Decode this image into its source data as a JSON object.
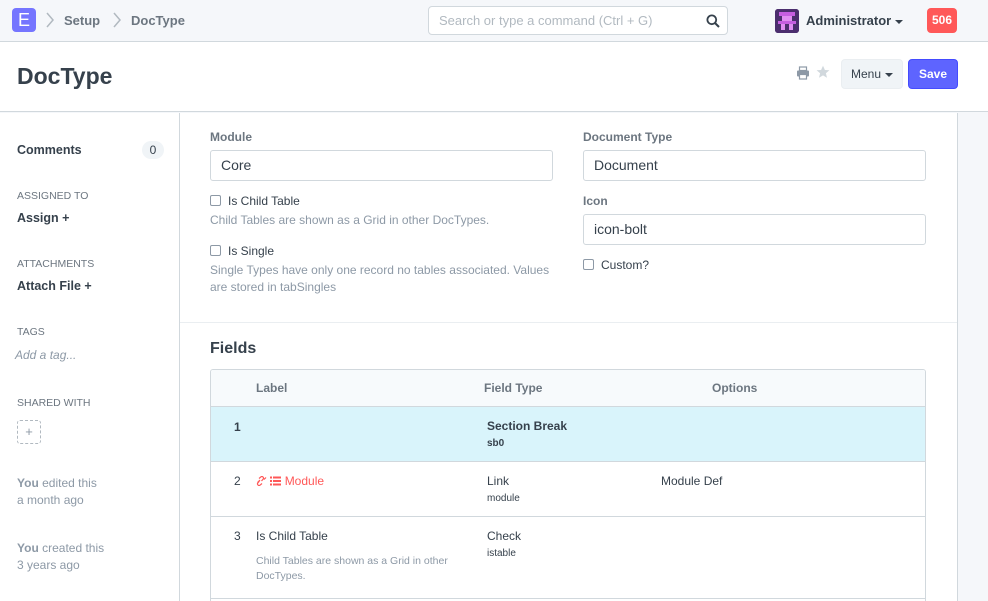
{
  "navbar": {
    "logo_letter": "E",
    "breadcrumbs": [
      "Setup",
      "DocType"
    ],
    "search_placeholder": "Search or type a command (Ctrl + G)",
    "user_name": "Administrator",
    "notification_count": "506"
  },
  "page": {
    "title": "DocType",
    "menu_label": "Menu",
    "save_label": "Save"
  },
  "sidebar": {
    "comments_label": "Comments",
    "comments_count": "0",
    "assigned_to_label": "ASSIGNED TO",
    "assign_link": "Assign",
    "attachments_label": "ATTACHMENTS",
    "attach_link": "Attach File",
    "tags_label": "TAGS",
    "add_tag_placeholder": "Add a tag...",
    "shared_with_label": "SHARED WITH",
    "share_add": "+",
    "activity": [
      {
        "who": "You",
        "line1": " edited this",
        "line2": "a month ago"
      },
      {
        "who": "You",
        "line1": " created this",
        "line2": "3 years ago"
      }
    ]
  },
  "form": {
    "module_label": "Module",
    "module_value": "Core",
    "is_child_table_label": "Is Child Table",
    "is_child_table_help": "Child Tables are shown as a Grid in other DocTypes.",
    "is_single_label": "Is Single",
    "is_single_help": "Single Types have only one record no tables associated. Values are stored in tabSingles",
    "document_type_label": "Document Type",
    "document_type_value": "Document",
    "icon_label": "Icon",
    "icon_value": "icon-bolt",
    "custom_label": "Custom?"
  },
  "fields_section": {
    "title": "Fields",
    "columns": [
      "Label",
      "Field Type",
      "Options"
    ],
    "rows": [
      {
        "idx": "1",
        "label": "",
        "fieldtype": "Section Break",
        "fieldname": "sb0",
        "options": "",
        "description": "",
        "highlighted": true
      },
      {
        "idx": "2",
        "label": "Module",
        "fieldtype": "Link",
        "fieldname": "module",
        "options": "Module Def",
        "description": "",
        "highlighted": false
      },
      {
        "idx": "3",
        "label": "Is Child Table",
        "fieldtype": "Check",
        "fieldname": "istable",
        "options": "",
        "description": "Child Tables are shown as a Grid in other DocTypes.",
        "highlighted": false
      }
    ]
  },
  "colors": {
    "primary": "#5e64ff",
    "notification": "#ff5858",
    "highlight_row": "#d9f4fb"
  }
}
